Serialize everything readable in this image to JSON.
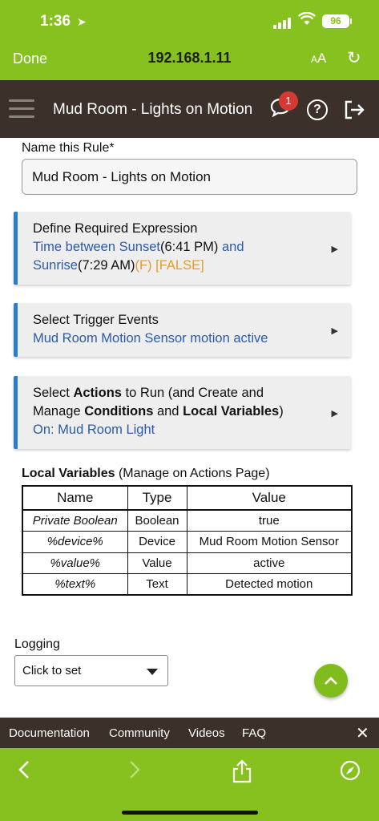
{
  "status_bar": {
    "time": "1:36",
    "battery": "96"
  },
  "browser": {
    "done": "Done",
    "url": "192.168.1.11",
    "aa": "AA"
  },
  "header": {
    "title": "Mud Room - Lights on Motion",
    "notifications": "1"
  },
  "rule": {
    "name_label": "Name this Rule*",
    "name_value": "Mud Room - Lights on Motion"
  },
  "sections": {
    "expression": {
      "title": "Define Required Expression",
      "part1": "Time between Sunset",
      "part2": "(6:41 PM)",
      "part3": " and ",
      "part4": "Sunrise",
      "part5": "(7:29 AM)",
      "part6": "(F)",
      "part7": " [FALSE]"
    },
    "triggers": {
      "title": "Select Trigger Events",
      "detail": "Mud Room Motion Sensor motion active"
    },
    "actions": {
      "t1": "Select ",
      "t2": "Actions",
      "t3": " to Run (and Create and",
      "t4": "Manage ",
      "t5": "Conditions",
      "t6": " and ",
      "t7": "Local Variables",
      "t8": ")",
      "detail": "On: Mud Room Light"
    }
  },
  "local_variables": {
    "title_bold": "Local Variables",
    "title_rest": " (Manage on Actions Page)",
    "headers": [
      "Name",
      "Type",
      "Value"
    ],
    "rows": [
      [
        "Private Boolean",
        "Boolean",
        "true"
      ],
      [
        "%device%",
        "Device",
        "Mud Room Motion Sensor"
      ],
      [
        "%value%",
        "Value",
        "active"
      ],
      [
        "%text%",
        "Text",
        "Detected motion"
      ]
    ]
  },
  "logging": {
    "label": "Logging",
    "value": "Click to set"
  },
  "footer_links": [
    "Documentation",
    "Community",
    "Videos",
    "FAQ"
  ],
  "colors": {
    "green": "#86c11f",
    "header": "#3b302a",
    "accent_blue": "#2a7ccc",
    "link_blue": "#2c5aa8",
    "orange": "#e79a28",
    "badge_red": "#d43a33"
  }
}
